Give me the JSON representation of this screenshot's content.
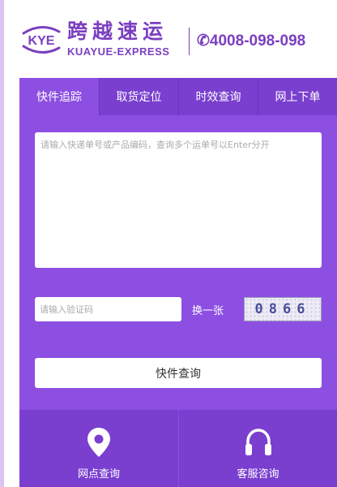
{
  "brand": {
    "logo_text": "KYE",
    "name_cn": "跨越速运",
    "name_en": "KUAYUE-EXPRESS",
    "phone": "✆4008-098-098",
    "color": "#7b3fc0"
  },
  "tabs": [
    {
      "label": "快件追踪",
      "active": true
    },
    {
      "label": "取货定位",
      "active": false
    },
    {
      "label": "时效查询",
      "active": false
    },
    {
      "label": "网上下单",
      "active": false
    }
  ],
  "tracking": {
    "placeholder": "请输入快递单号或产品编码，查询多个运单号以Enter分开",
    "value": ""
  },
  "captcha": {
    "placeholder": "请输入验证码",
    "refresh_label": "换一张",
    "code": "0866"
  },
  "query_button": "快件查询",
  "bottom_nav": [
    {
      "label": "网点查询",
      "icon": "location-pin-icon"
    },
    {
      "label": "客服咨询",
      "icon": "headset-icon"
    }
  ],
  "colors": {
    "panel": "#8d4fe2",
    "tab_inactive": "#7a3fcf",
    "left_stripe": "#d9c4f2"
  }
}
